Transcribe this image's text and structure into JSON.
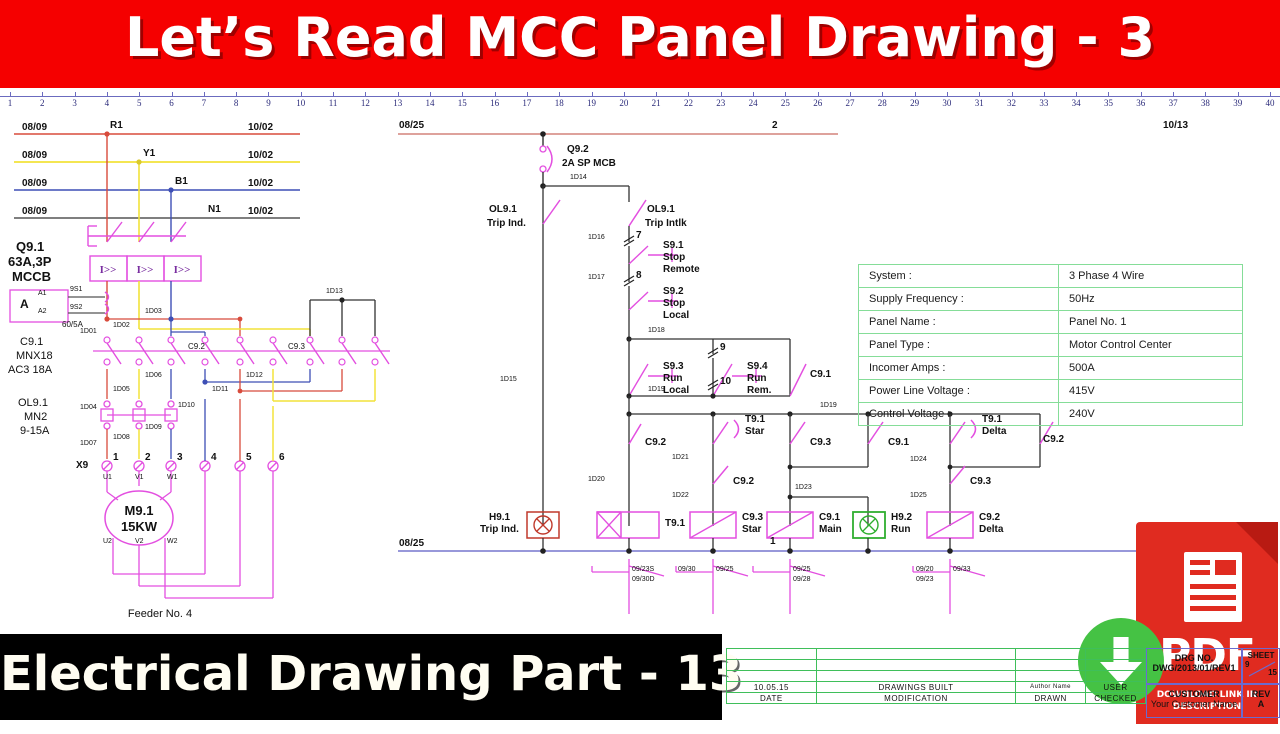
{
  "banner": {
    "title": "Let’s Read MCC Panel Drawing - 3"
  },
  "footer": {
    "title": "Electrical Drawing Part - 13"
  },
  "ruler": {
    "min": 1,
    "max": 40
  },
  "power": {
    "bus_left_refs": [
      "08/09",
      "08/09",
      "08/09",
      "08/09"
    ],
    "bus_right_refs": [
      "10/02",
      "10/02",
      "10/02",
      "10/02"
    ],
    "phase_labels": [
      "R1",
      "Y1",
      "B1",
      "N1"
    ],
    "mccb": {
      "tag": "Q9.1",
      "rating": "63A,3P",
      "type": "MCCB",
      "element": "I>>"
    },
    "ammeter": {
      "symbol": "A",
      "t1": "A1",
      "t2": "A2",
      "w1": "9S1",
      "w2": "9S2",
      "ct": "60/5A"
    },
    "contactor": {
      "tag": "C9.1",
      "model": "MNX18",
      "duty": "AC3 18A"
    },
    "contactor2": "C9.2",
    "contactor3": "C9.3",
    "overload": {
      "tag": "OL9.1",
      "model": "MN2",
      "range": "9-15A"
    },
    "terminal_strip": "X9",
    "terminal_numbers": [
      "1",
      "2",
      "3",
      "4",
      "5",
      "6"
    ],
    "motor_terminals_top": [
      "U1",
      "V1",
      "W1"
    ],
    "motor_terminals_bottom": [
      "U2",
      "V2",
      "W2"
    ],
    "motor": {
      "tag": "M9.1",
      "rating": "15KW"
    },
    "feeder": "Feeder No. 4",
    "wire_numbers": [
      "1D01",
      "1D02",
      "1D03",
      "1D04",
      "1D05",
      "1D06",
      "1D07",
      "1D08",
      "1D09",
      "1D10",
      "1D11",
      "1D12",
      "1D13"
    ]
  },
  "control": {
    "top_ref_left": "08/25",
    "top_ref_center": "2",
    "top_ref_right": "10/13",
    "bottom_ref_left": "08/25",
    "bottom_ref_center": "1",
    "mcb": {
      "tag": "Q9.2",
      "rating": "2A SP MCB"
    },
    "ol_trip_ind": {
      "tag": "OL9.1",
      "desc": "Trip Ind."
    },
    "ol_trip_intlk": {
      "tag": "OL9.1",
      "desc": "Trip Intlk"
    },
    "switches": [
      {
        "tag": "S9.1",
        "l1": "Stop",
        "l2": "Remote",
        "terminal": "7",
        "wire": "1D16"
      },
      {
        "tag": "S9.2",
        "l1": "Stop",
        "l2": "Local",
        "terminal": "8",
        "wire": "1D17"
      },
      {
        "tag": "S9.3",
        "l1": "Run",
        "l2": "Local",
        "terminal": "9",
        "wire": "1D18"
      },
      {
        "tag": "S9.4",
        "l1": "Run",
        "l2": "Rem.",
        "terminal": "10",
        "wire": "1D19"
      }
    ],
    "seal_in": "C9.1",
    "contacts": [
      {
        "tag": "C9.2"
      },
      {
        "tag": "T9.1",
        "sub": "Star"
      },
      {
        "tag": "C9.2"
      },
      {
        "tag": "C9.3"
      },
      {
        "tag": "C9.1"
      },
      {
        "tag": "T9.1",
        "sub": "Delta"
      },
      {
        "tag": "C9.2"
      },
      {
        "tag": "C9.3"
      }
    ],
    "coils": [
      {
        "tag": "T9.1",
        "sub": "",
        "kind": "timer",
        "wire": "1D20"
      },
      {
        "tag": "C9.3",
        "sub": "Star",
        "kind": "coil",
        "wire": "1D22"
      },
      {
        "tag": "C9.1",
        "sub": "Main",
        "kind": "coil",
        "wire": "1D23"
      },
      {
        "tag": "H9.2",
        "sub": "Run",
        "kind": "lamp-green",
        "wire": ""
      },
      {
        "tag": "C9.2",
        "sub": "Delta",
        "kind": "coil",
        "wire": "1D25"
      }
    ],
    "trip_lamp": {
      "tag": "H9.1",
      "desc": "Trip Ind."
    },
    "wires": [
      "1D14",
      "1D15",
      "1D16",
      "1D17",
      "1D18",
      "1D19",
      "1D19",
      "1D20",
      "1D21",
      "1D22",
      "1D23",
      "1D24",
      "1D25"
    ],
    "xrefs": [
      {
        "a": "09/23S",
        "b": "09/30D"
      },
      {
        "a": "09/30",
        "b": "09/25"
      },
      {
        "a": "09/25",
        "b": "09/28"
      },
      {
        "a": "09/20",
        "b": "09/33"
      },
      {
        "a": "09/23",
        "b": ""
      }
    ]
  },
  "spec_table": {
    "rows": [
      {
        "key": "System :",
        "value": "3 Phase 4 Wire"
      },
      {
        "key": "Supply Frequency :",
        "value": "50Hz"
      },
      {
        "key": "Panel Name :",
        "value": "Panel No. 1"
      },
      {
        "key": "Panel Type :",
        "value": "Motor Control Center"
      },
      {
        "key": "Incomer Amps :",
        "value": "500A"
      },
      {
        "key": "Power Line Voltage :",
        "value": "415V"
      },
      {
        "key": "Control Voltage :",
        "value": "240V"
      }
    ]
  },
  "pdf_badge": {
    "format": "PDF",
    "line1": "DOWNLOAD LINK IN",
    "line2": "DESCRIPTION"
  },
  "title_block": {
    "rev_headers": [
      "DATE",
      "MODIFICATION",
      "DRAWN",
      "CHECKED"
    ],
    "rev_row": [
      "10.05.15",
      "DRAWINGS BUILT",
      "Author Name",
      "USER"
    ],
    "drg_no_label": "DRG NO.",
    "drg_no": "DWG/2013/01/REV1",
    "customer_label": "CUSTOMER",
    "customer": "Your Customer Name",
    "sheet_label": "SHEET",
    "sheet_num": "9",
    "sheet_total": "15",
    "rev_label": "REV",
    "rev_value": "A"
  },
  "colors": {
    "banner": "#f50000",
    "phase_r": "#d84b3c",
    "phase_y": "#f2e23a",
    "phase_b": "#3d4fb5",
    "neutral": "#555555",
    "magenta": "#e34fe0",
    "green": "#45c244",
    "blue_bus": "#8a8ad4"
  }
}
